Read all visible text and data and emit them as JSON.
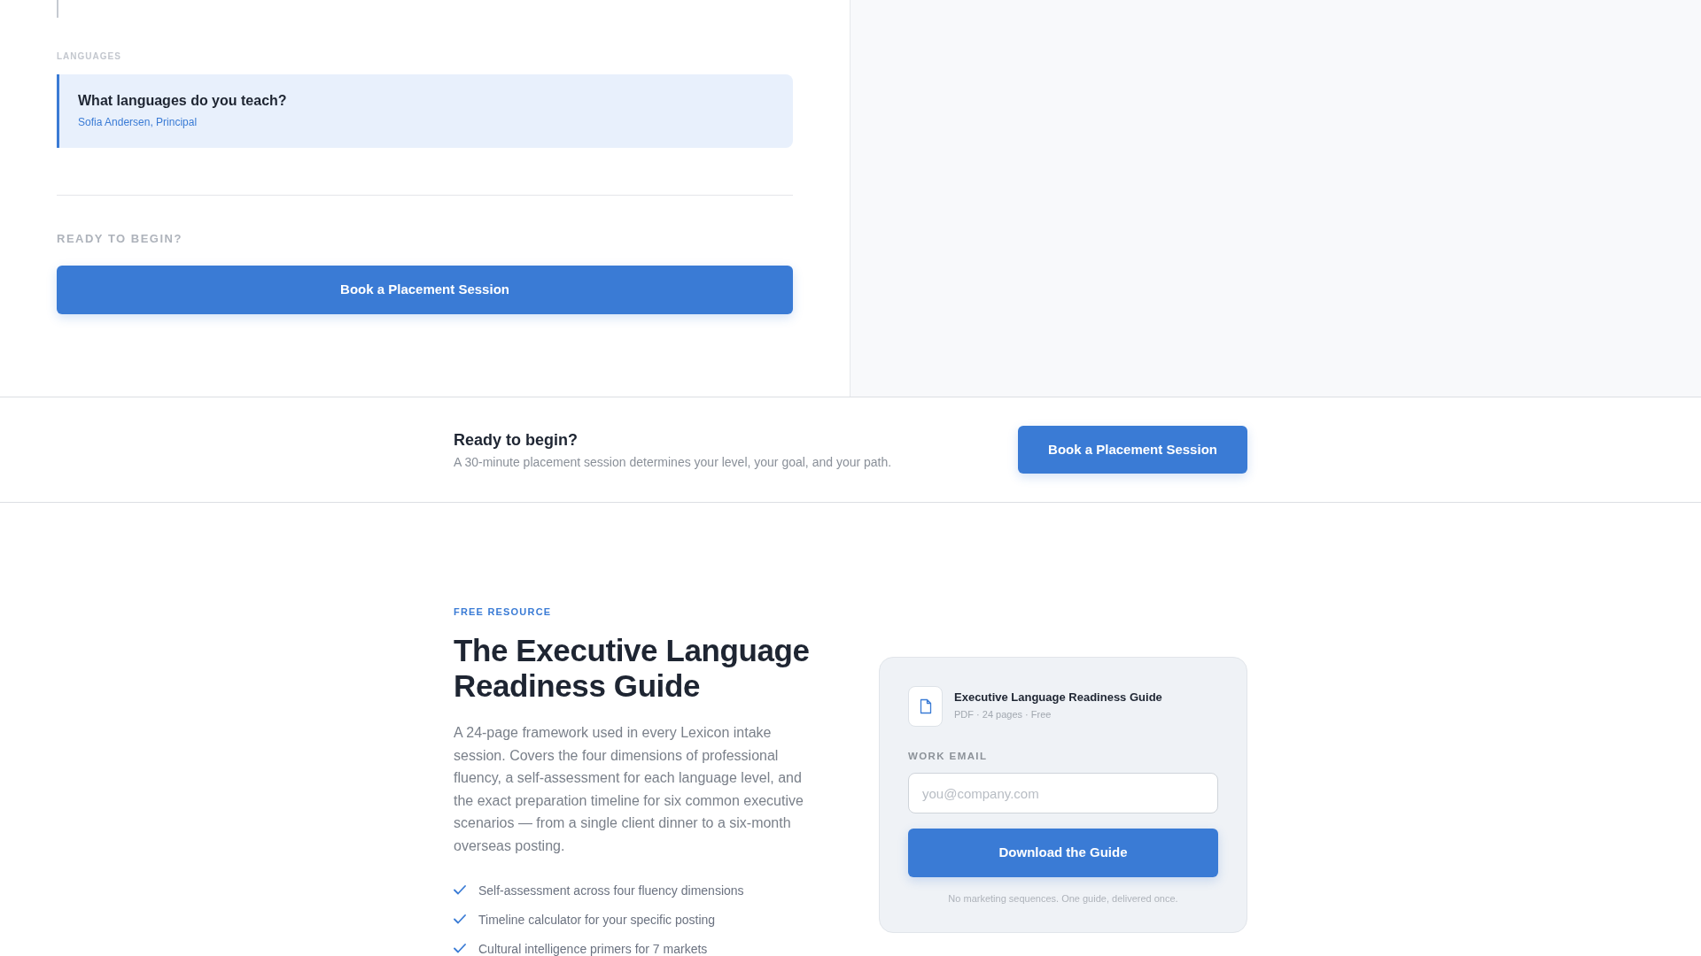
{
  "faq_panel": {
    "section_label": "LANGUAGES",
    "questions": [
      {
        "question": "What languages do you teach?",
        "answered_by": "Sofia Andersen, Principal"
      }
    ],
    "cta_label": "READY TO BEGIN?",
    "cta_button": "Book a Placement Session"
  },
  "cta_band": {
    "title": "Ready to begin?",
    "subtitle": "A 30-minute placement session determines your level, your goal, and your path.",
    "button": "Book a Placement Session"
  },
  "free_resource": {
    "eyebrow": "FREE RESOURCE",
    "title": "The Executive Language Readiness Guide",
    "description": "A 24-page framework used in every Lexicon intake session. Covers the four dimensions of professional fluency, a self-assessment for each language level, and the exact preparation timeline for six common executive scenarios — from a single client dinner to a six-month overseas posting.",
    "features": [
      "Self-assessment across four fluency dimensions",
      "Timeline calculator for your specific posting",
      "Cultural intelligence primers for 7 markets"
    ],
    "download_card": {
      "file_title": "Executive Language Readiness Guide",
      "file_meta": "PDF · 24 pages · Free",
      "email_label": "WORK EMAIL",
      "email_placeholder": "you@company.com",
      "button": "Download the Guide",
      "note": "No marketing sequences. One guide, delivered once."
    }
  }
}
